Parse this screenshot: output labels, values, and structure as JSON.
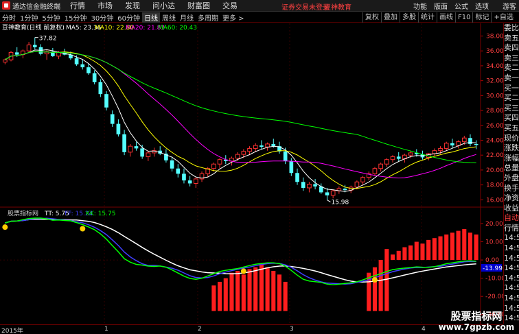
{
  "app_title": "通达信金融终端",
  "menu": [
    "行情",
    "市场",
    "发现",
    "问小达",
    "财富圈",
    "交易"
  ],
  "promo": "证券交易未登录",
  "promo_brand": "豆神教育",
  "top_right": [
    "功能",
    "版面",
    "公式",
    "选项"
  ],
  "guest": "游客",
  "periods": [
    "分时",
    "1分钟",
    "5分钟",
    "15分钟",
    "30分钟",
    "60分钟",
    "日线",
    "周线",
    "月线",
    "多周期",
    "更多 >"
  ],
  "active_period": "日线",
  "tools": [
    "复权",
    "叠加",
    "多股",
    "统计",
    "画线",
    "F10",
    "标记",
    "+自选"
  ],
  "stock_name": "豆神教育(日线 前复权)",
  "ma": [
    {
      "label": "MA5: 23.36",
      "color": "#ffffff"
    },
    {
      "label": "MA10: 22.80",
      "color": "#ffff00"
    },
    {
      "label": "MA20: 21.83",
      "color": "#ff00ff"
    },
    {
      "label": "MA60: 20.43",
      "color": "#00ff00"
    }
  ],
  "indicator": {
    "name": "股票指标网",
    "tt": "TT: 5.75",
    "ff": "FF: 15.24",
    "kk": "KK: 15.75",
    "tt_color": "#ffffff",
    "ff_color": "#4040ff",
    "kk_color": "#00ff00",
    "current_value": "-13.99"
  },
  "price_axis": [
    "38.00",
    "36.00",
    "34.00",
    "32.00",
    "30.00",
    "28.00",
    "26.00",
    "24.00",
    "22.00",
    "20.00",
    "18.00",
    "16.00"
  ],
  "price_annotations": {
    "high": "37.82",
    "low": "15.98"
  },
  "ind_axis": [
    "20.00",
    "10.00",
    "0.00",
    "-10.00",
    "-20.00",
    "-30.00"
  ],
  "right_panel": [
    "委比",
    "卖五",
    "卖四",
    "卖三",
    "卖二",
    "卖一",
    "买一",
    "买二",
    "买三",
    "买四",
    "买五",
    "现价",
    "涨跌",
    "涨幅",
    "总量",
    "外盘",
    "换手",
    "净资",
    "收益",
    "自动",
    "行情",
    "14:5",
    "14:5",
    "14:5",
    "14:5",
    "14:5",
    "14:5",
    "14:5",
    "14:5",
    "14:5"
  ],
  "date_axis": [
    "2015年",
    "1",
    "2",
    "3",
    "4"
  ],
  "watermark": {
    "line1": "股票指标网",
    "line2": "www.7gpzb.com"
  },
  "chart_data": {
    "type": "candlestick",
    "candles": [
      [
        34.5,
        35.0,
        34.2,
        34.8
      ],
      [
        34.8,
        36.0,
        34.6,
        35.8
      ],
      [
        35.8,
        36.5,
        35.2,
        35.5
      ],
      [
        35.5,
        36.2,
        35.0,
        36.0
      ],
      [
        36.0,
        37.2,
        35.8,
        36.8
      ],
      [
        36.8,
        37.8,
        36.2,
        36.5
      ],
      [
        36.5,
        36.9,
        35.4,
        35.6
      ],
      [
        35.6,
        36.2,
        34.8,
        35.9
      ],
      [
        35.9,
        36.4,
        35.2,
        35.3
      ],
      [
        35.3,
        36.0,
        34.9,
        35.8
      ],
      [
        35.8,
        36.3,
        35.4,
        35.5
      ],
      [
        35.5,
        35.9,
        34.8,
        35.0
      ],
      [
        35.0,
        35.4,
        34.0,
        34.2
      ],
      [
        34.2,
        34.8,
        33.5,
        33.8
      ],
      [
        33.8,
        34.3,
        32.8,
        33.0
      ],
      [
        33.0,
        33.4,
        31.5,
        31.8
      ],
      [
        31.8,
        32.2,
        29.8,
        30.2
      ],
      [
        30.2,
        30.6,
        28.0,
        28.4
      ],
      [
        27.5,
        28.0,
        25.8,
        26.2
      ],
      [
        26.2,
        26.8,
        24.5,
        24.8
      ],
      [
        24.8,
        25.4,
        22.0,
        22.4
      ],
      [
        22.4,
        23.5,
        21.8,
        23.2
      ],
      [
        23.2,
        23.8,
        22.6,
        22.9
      ],
      [
        22.9,
        23.4,
        21.5,
        21.8
      ],
      [
        21.8,
        22.6,
        21.2,
        22.3
      ],
      [
        22.3,
        23.0,
        21.8,
        22.6
      ],
      [
        22.6,
        23.2,
        22.0,
        22.2
      ],
      [
        22.2,
        22.8,
        21.0,
        21.3
      ],
      [
        21.3,
        21.8,
        19.8,
        20.2
      ],
      [
        20.2,
        20.8,
        19.0,
        19.5
      ],
      [
        19.5,
        20.2,
        18.2,
        18.6
      ],
      [
        18.6,
        19.2,
        17.8,
        18.2
      ],
      [
        18.2,
        19.0,
        17.6,
        18.8
      ],
      [
        18.8,
        19.8,
        18.4,
        19.5
      ],
      [
        19.5,
        20.4,
        19.0,
        20.2
      ],
      [
        20.2,
        21.0,
        19.8,
        20.8
      ],
      [
        20.8,
        21.6,
        20.2,
        21.4
      ],
      [
        21.4,
        22.0,
        20.8,
        21.2
      ],
      [
        21.2,
        21.8,
        20.6,
        21.6
      ],
      [
        21.6,
        22.4,
        21.2,
        22.1
      ],
      [
        22.1,
        22.8,
        21.6,
        22.5
      ],
      [
        22.5,
        23.2,
        22.0,
        22.9
      ],
      [
        22.9,
        23.6,
        22.4,
        23.3
      ],
      [
        23.3,
        24.0,
        22.8,
        23.1
      ],
      [
        23.1,
        23.7,
        22.6,
        23.5
      ],
      [
        23.5,
        24.2,
        23.0,
        23.2
      ],
      [
        23.2,
        23.8,
        22.2,
        22.5
      ],
      [
        22.5,
        23.0,
        20.8,
        21.2
      ],
      [
        21.2,
        21.6,
        19.2,
        19.6
      ],
      [
        19.6,
        20.2,
        18.0,
        18.4
      ],
      [
        18.4,
        19.0,
        17.2,
        17.6
      ],
      [
        17.6,
        18.4,
        17.0,
        18.1
      ],
      [
        18.1,
        18.8,
        17.4,
        17.8
      ],
      [
        17.8,
        18.2,
        16.8,
        17.0
      ],
      [
        17.0,
        17.6,
        15.98,
        16.6
      ],
      [
        16.6,
        17.4,
        16.2,
        17.2
      ],
      [
        17.2,
        17.8,
        16.8,
        17.5
      ],
      [
        17.5,
        18.0,
        17.0,
        17.3
      ],
      [
        17.3,
        17.9,
        16.9,
        17.7
      ],
      [
        17.7,
        18.6,
        17.4,
        18.4
      ],
      [
        18.4,
        19.2,
        18.0,
        19.0
      ],
      [
        19.0,
        19.8,
        18.6,
        19.5
      ],
      [
        19.5,
        20.4,
        19.2,
        20.2
      ],
      [
        20.2,
        21.0,
        19.8,
        20.8
      ],
      [
        20.8,
        21.6,
        20.4,
        21.4
      ],
      [
        21.4,
        22.0,
        21.0,
        21.8
      ],
      [
        21.8,
        22.4,
        21.2,
        21.5
      ],
      [
        21.5,
        22.2,
        21.0,
        22.0
      ],
      [
        22.0,
        22.6,
        21.6,
        22.3
      ],
      [
        22.3,
        22.8,
        21.8,
        22.1
      ],
      [
        22.1,
        22.6,
        21.4,
        21.7
      ],
      [
        21.7,
        22.3,
        21.3,
        22.2
      ],
      [
        22.2,
        22.9,
        21.9,
        22.6
      ],
      [
        22.6,
        23.2,
        22.2,
        22.9
      ],
      [
        22.9,
        23.8,
        22.6,
        23.6
      ],
      [
        23.6,
        24.2,
        23.0,
        23.3
      ],
      [
        23.3,
        24.0,
        22.9,
        23.8
      ],
      [
        23.8,
        24.6,
        23.4,
        24.3
      ],
      [
        24.3,
        24.8,
        23.2,
        23.5
      ],
      [
        23.5,
        24.0,
        22.8,
        23.36
      ]
    ],
    "ylim": [
      15.2,
      38.6
    ],
    "indicator_bars": [
      0,
      0,
      0,
      0,
      0,
      0,
      0,
      0,
      0,
      0,
      0,
      0,
      0,
      0,
      0,
      0,
      0,
      0,
      0,
      0,
      0,
      0,
      0,
      0,
      0,
      0,
      0,
      0,
      0,
      0,
      0,
      0,
      0,
      0,
      0,
      -22,
      -20,
      -18,
      -15,
      -14,
      -16,
      -13,
      -12,
      -10,
      -12,
      -14,
      -16,
      -20,
      0,
      0,
      0,
      0,
      0,
      0,
      0,
      0,
      0,
      0,
      0,
      0,
      0,
      -15,
      -12,
      -8,
      -2,
      3,
      5,
      7,
      8,
      10,
      9,
      11,
      12,
      13,
      14,
      15,
      16,
      17,
      15,
      14
    ],
    "ind_ylim": [
      -35,
      23
    ]
  }
}
